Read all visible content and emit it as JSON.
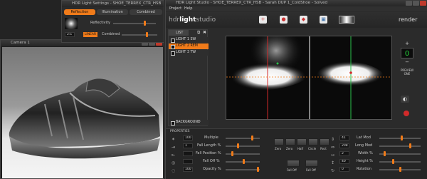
{
  "settings_window": {
    "title": "HDR Light Settings - SHOE_TERREX_CTR_HSB",
    "tabs": [
      {
        "label": "Reflection"
      },
      {
        "label": "Illumination"
      },
      {
        "label": "Combined"
      }
    ],
    "reflectivity_label": "Reflectivity",
    "mode_value": "2:1",
    "linear_label": "LINEAR",
    "combined_label": "Combined"
  },
  "viewport_window": {
    "title": "Camera 1"
  },
  "studio_window": {
    "title": "HDR Light Studio - SHOE_TERREX_CTR_HSB - Sarah DUP 1_ColdShoe - Solved",
    "menu": [
      "Project",
      "Help"
    ],
    "logo_prefix": "hdr",
    "logo_main": "light",
    "logo_suffix": "studio",
    "render_label": "render",
    "toolbar_icons": [
      "add-light-icon",
      "add-spot-icon",
      "add-area-icon",
      "image-icon",
      "gradient-icon"
    ],
    "list_tab": "LIST",
    "lights": [
      {
        "label": "LIGHT 1 SW",
        "selected": false
      },
      {
        "label": "LIGHT 2 REM",
        "selected": true
      },
      {
        "label": "LIGHT 3 TW",
        "selected": false
      }
    ],
    "background_label": "BACKGROUND",
    "counter_value": "0",
    "preview_label": "PREVIEW\nONE",
    "properties_label": "PROPERTIES",
    "left_props": [
      {
        "value": "100",
        "label": "Multiple"
      },
      {
        "value": "1",
        "label": "Fall Length %"
      },
      {
        "value": "",
        "label": "Fall Position %"
      },
      {
        "value": "",
        "label": "Fall Off %"
      },
      {
        "value": "100",
        "label": "Opacity %"
      }
    ],
    "shape_labels": [
      "Zero",
      "Zero",
      "Half",
      "Circle",
      "Rect",
      "Fall Off",
      "Fall Off"
    ],
    "right_props": [
      {
        "value": "41",
        "label": "Lat Mod"
      },
      {
        "value": "208",
        "label": "Long Mod"
      },
      {
        "value": "2",
        "label": "Width %"
      },
      {
        "value": "40",
        "label": "Height %"
      },
      {
        "value": "0",
        "label": "Rotation"
      }
    ]
  },
  "colors": {
    "accent": "#f07b1a",
    "counter_green": "#27d13c",
    "red_line": "#d22a2a",
    "green_line": "#2ac24a"
  }
}
